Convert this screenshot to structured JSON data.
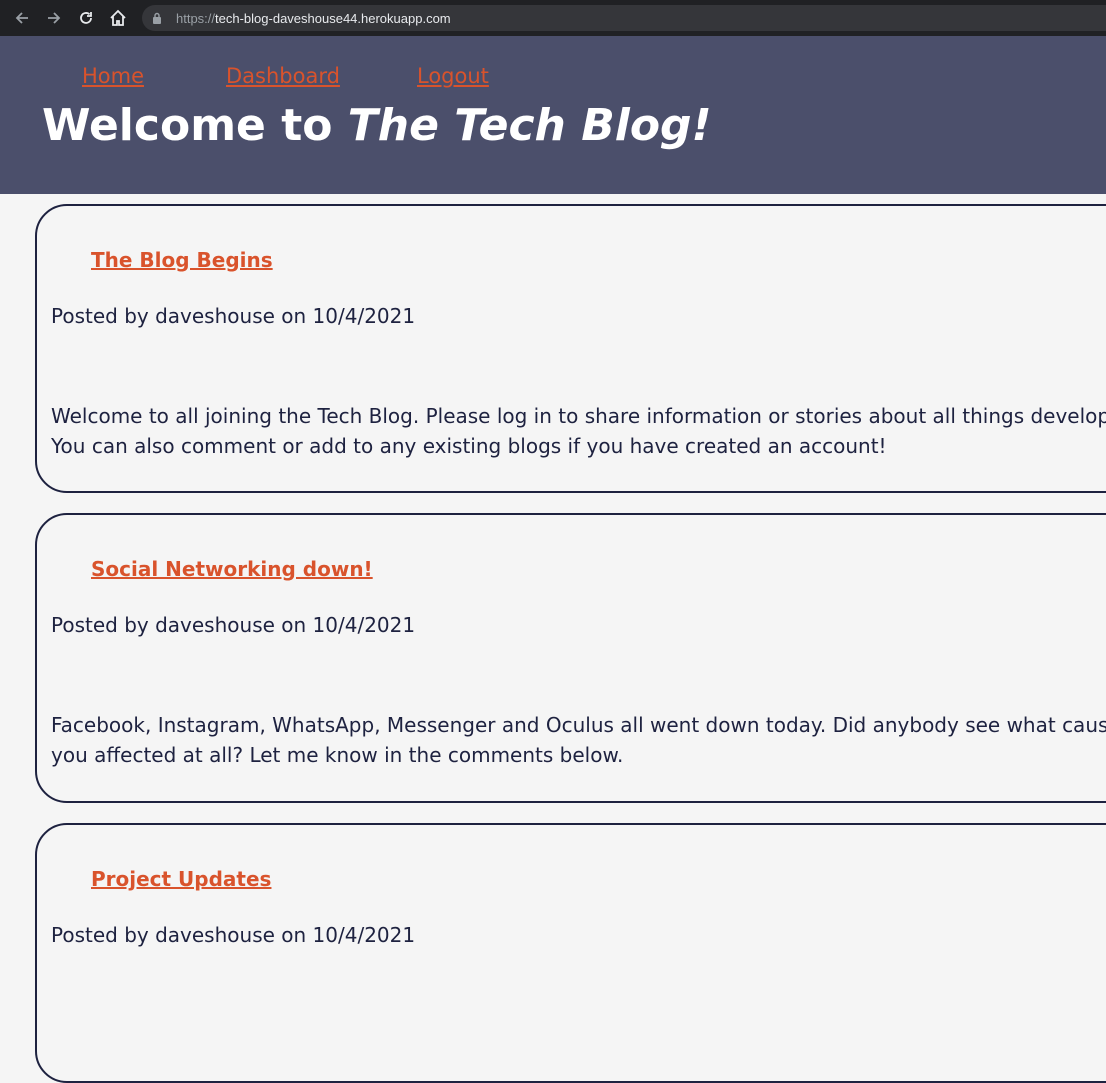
{
  "browser": {
    "url_scheme": "https://",
    "url_host": "tech-blog-daveshouse44.herokuapp.com"
  },
  "nav": {
    "home": "Home",
    "dashboard": "Dashboard",
    "logout": "Logout"
  },
  "header": {
    "title_prefix": "Welcome to ",
    "title_emphasis": "The Tech Blog!"
  },
  "posts": [
    {
      "title": "The Blog Begins",
      "meta": "Posted by daveshouse on 10/4/2021",
      "body_line1": "Welcome to all joining the Tech Blog. Please log in to share information or stories about all things developme",
      "body_line2": "You can also comment or add to any existing blogs if you have created an account!"
    },
    {
      "title": "Social Networking down!",
      "meta": "Posted by daveshouse on 10/4/2021",
      "body_line1": "Facebook, Instagram, WhatsApp, Messenger and Oculus all went down today. Did anybody see what caused t",
      "body_line2": "you affected at all? Let me know in the comments below."
    },
    {
      "title": "Project Updates",
      "meta": "Posted by daveshouse on 10/4/2021"
    }
  ],
  "colors": {
    "header_bg": "#4b4f6b",
    "link": "#d9532c",
    "text": "#1e2240",
    "page_bg": "#f5f5f5"
  }
}
